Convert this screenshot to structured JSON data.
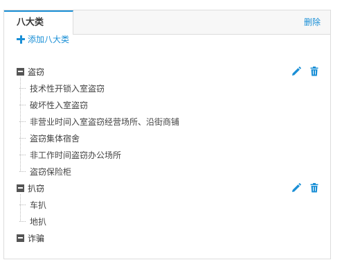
{
  "tab": {
    "label": "八大类"
  },
  "header": {
    "delete_label": "删除"
  },
  "add": {
    "label": "添加八大类"
  },
  "tree": [
    {
      "label": "盗窃",
      "children": [
        "技术性开锁入室盗窃",
        "破坏性入室盗窃",
        "非营业时间入室盗窃经营场所、沿街商铺",
        "盗窃集体宿舍",
        "非工作时间盗窃办公场所",
        "盗窃保险柜"
      ]
    },
    {
      "label": "扒窃",
      "children": [
        "车扒",
        "地扒"
      ]
    },
    {
      "label": "诈骗",
      "children": []
    }
  ],
  "colors": {
    "accent": "#1a8fd6"
  },
  "icons": {
    "edit": "pencil-icon",
    "delete": "trash-icon",
    "collapse": "minus-square-icon",
    "add": "plus-icon"
  }
}
